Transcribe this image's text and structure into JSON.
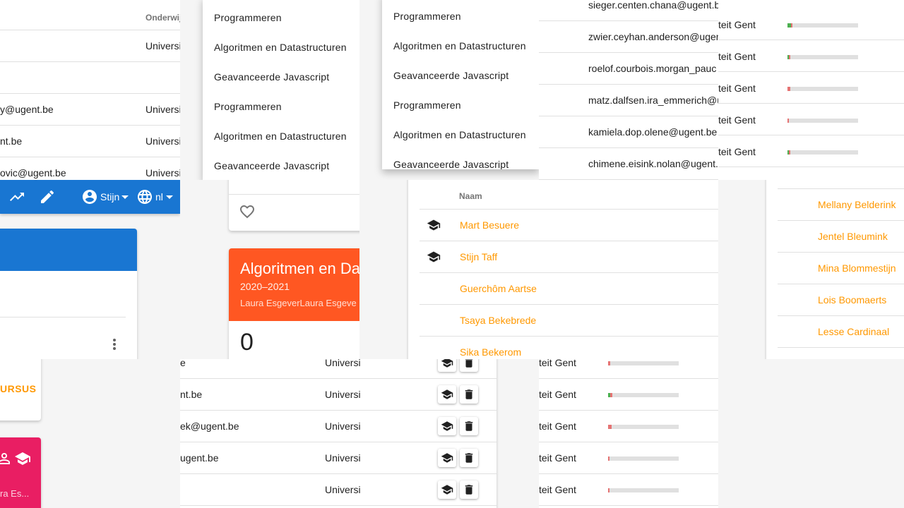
{
  "users_top": {
    "header_institution": "Onderwijs",
    "rows": [
      {
        "email": "",
        "institution": "Universi"
      },
      {
        "email": "",
        "institution": ""
      },
      {
        "email": "y@ugent.be",
        "institution": "Universi"
      },
      {
        "email": "nt.be",
        "institution": "Universi"
      },
      {
        "email": "ovic@ugent.be",
        "institution": "Universi"
      }
    ]
  },
  "topbar": {
    "user_label": "Stijn",
    "lang_label": "nl"
  },
  "left_cards": {
    "course_link": "URSUS",
    "pink_text": "ra Es..."
  },
  "menu1": {
    "items": [
      "Programmeren",
      "Algoritmen en Datastructuren",
      "Geavanceerde Javascript",
      "Programmeren",
      "Algoritmen en Datastructuren",
      "Geavanceerde Javascript"
    ]
  },
  "menu2": {
    "items": [
      "Programmeren",
      "Algoritmen en Datastructuren",
      "Geavanceerde Javascript",
      "Programmeren",
      "Algoritmen en Datastructuren",
      "Geavanceerde Javascript"
    ]
  },
  "course_card": {
    "title": "Algoritmen en Da",
    "year": "2020–2021",
    "teachers": "Laura EsgeverLaura Esgeve",
    "count": "0"
  },
  "emails_top": {
    "rows": [
      "sieger.centen.chana@ugent.b",
      "zwier.ceyhan.anderson@ugent",
      "roelof.courbois.morgan_pauc",
      "matz.dalfsen.ira_emmerich@u",
      "kamiela.dop.olene@ugent.be",
      "chimene.eisink.nolan@ugent."
    ]
  },
  "progress_top": {
    "rows": [
      {
        "institution": "teit Gent",
        "correct": 0.05,
        "wrong": 0.02
      },
      {
        "institution": "teit Gent",
        "correct": 0.02,
        "wrong": 0.02
      },
      {
        "institution": "teit Gent",
        "correct": 0.0,
        "wrong": 0.04
      },
      {
        "institution": "teit Gent",
        "correct": 0.0,
        "wrong": 0.02
      },
      {
        "institution": "teit Gent",
        "correct": 0.02,
        "wrong": 0.01
      }
    ]
  },
  "members": {
    "header_name": "Naam",
    "rows": [
      {
        "name": "Mart Besuere",
        "teacher": true
      },
      {
        "name": "Stijn Taff",
        "teacher": true
      },
      {
        "name": "Guerchôm Aartse",
        "teacher": false
      },
      {
        "name": "Tsaya Bekebrede",
        "teacher": false
      },
      {
        "name": "Sika Bekerom",
        "teacher": false
      }
    ]
  },
  "names_right": {
    "rows": [
      "Mellany Belderink",
      "Jentel Bleumink",
      "Mina Blommestijn",
      "Lois Boomaerts",
      "Lesse Cardinaal"
    ]
  },
  "users_bottom": {
    "rows": [
      {
        "email": "e",
        "institution": "Universi"
      },
      {
        "email": "nt.be",
        "institution": "Universi"
      },
      {
        "email": "ek@ugent.be",
        "institution": "Universi"
      },
      {
        "email": "ugent.be",
        "institution": "Universi"
      },
      {
        "email": "",
        "institution": "Universi"
      }
    ]
  },
  "progress_bottom": {
    "rows": [
      {
        "institution": "teit Gent",
        "correct": 0.0,
        "wrong": 0.03
      },
      {
        "institution": "teit Gent",
        "correct": 0.03,
        "wrong": 0.03
      },
      {
        "institution": "teit Gent",
        "correct": 0.0,
        "wrong": 0.05
      },
      {
        "institution": "teit Gent",
        "correct": 0.0,
        "wrong": 0.02
      },
      {
        "institution": "teit Gent",
        "correct": 0.0,
        "wrong": 0.02
      }
    ]
  },
  "colors": {
    "primary": "#1976d2",
    "accent": "#ff5722",
    "pink": "#e91e63",
    "link": "#ff9800",
    "correct": "#4caf50",
    "wrong": "#e57373"
  },
  "icons": {
    "trending": "trending-up-icon",
    "edit": "pencil-icon",
    "account": "account-circle-icon",
    "language": "globe-icon",
    "favorite": "heart-outline-icon",
    "teacher": "school-icon",
    "delete": "trash-icon",
    "more": "more-vert-icon"
  }
}
